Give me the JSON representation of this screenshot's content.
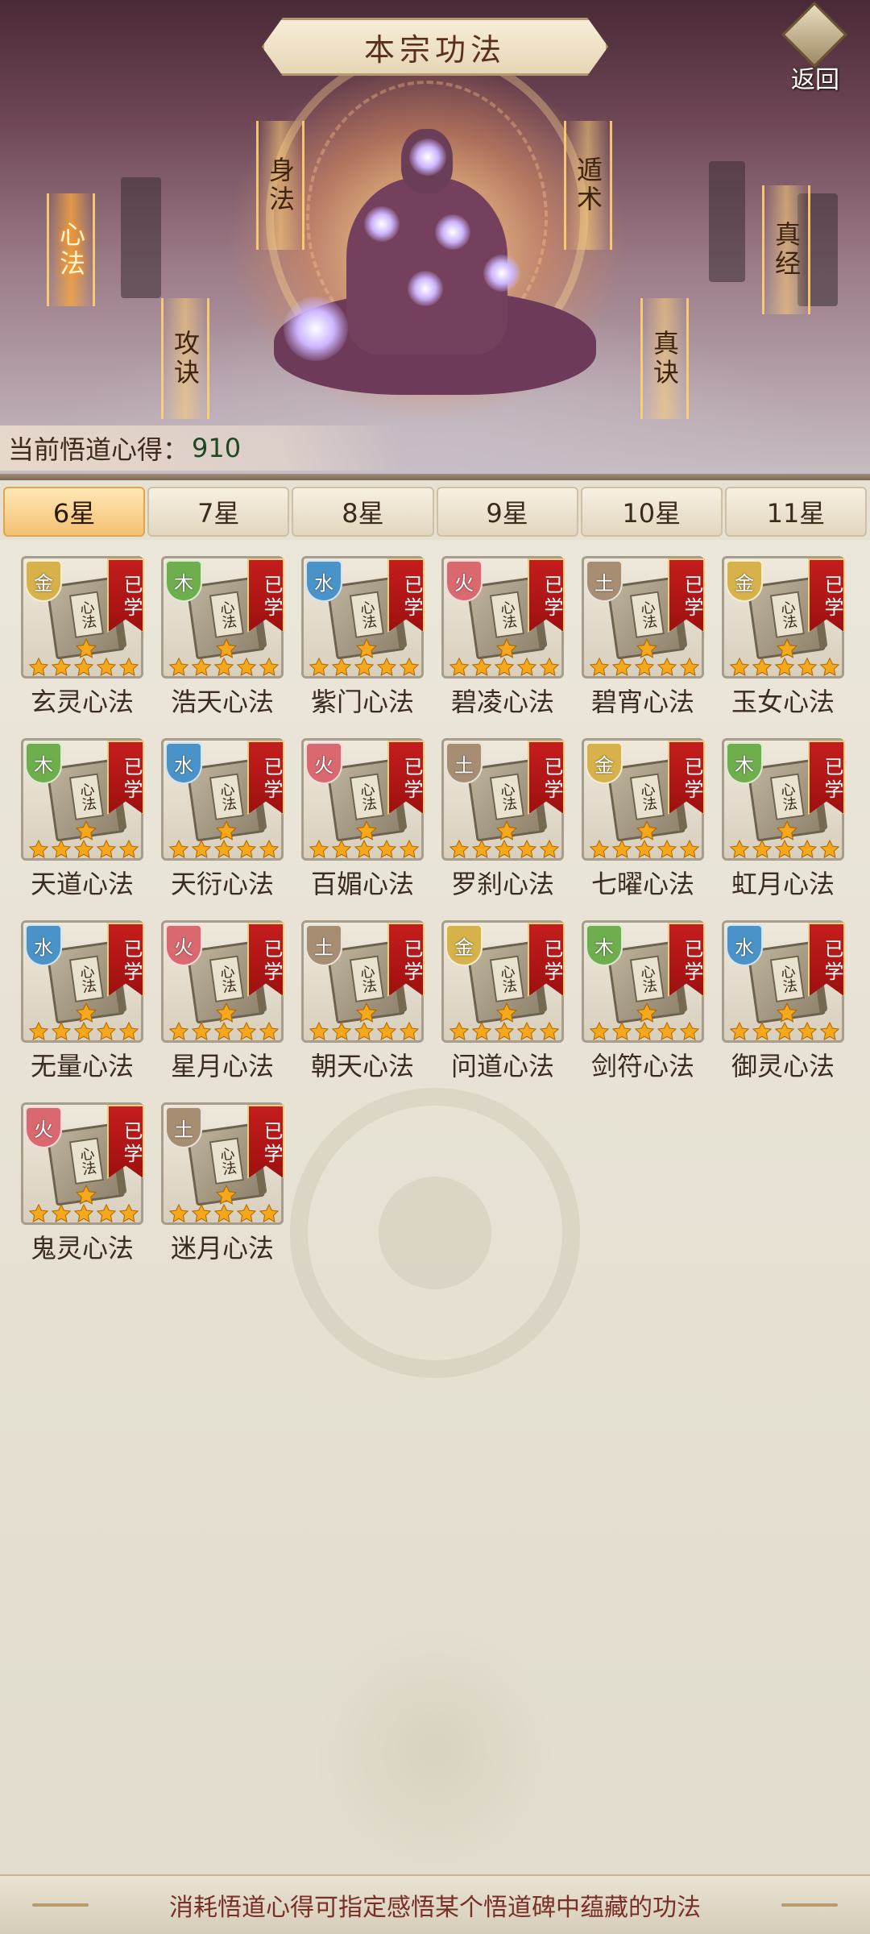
{
  "header": {
    "title": "本宗功法",
    "back_label": "返回"
  },
  "categories": [
    {
      "id": "xinfa",
      "label": "心法",
      "active": true
    },
    {
      "id": "shenfa",
      "label": "身法",
      "active": false
    },
    {
      "id": "gongjue",
      "label": "攻诀",
      "active": false
    },
    {
      "id": "dunshu",
      "label": "遁术",
      "active": false
    },
    {
      "id": "zhenjue",
      "label": "真诀",
      "active": false
    },
    {
      "id": "zhenjing",
      "label": "真经",
      "active": false
    }
  ],
  "insight": {
    "label": "当前悟道心得：",
    "value": "910"
  },
  "tabs": [
    {
      "label": "6星",
      "active": true
    },
    {
      "label": "7星",
      "active": false
    },
    {
      "label": "8星",
      "active": false
    },
    {
      "label": "9星",
      "active": false
    },
    {
      "label": "10星",
      "active": false
    },
    {
      "label": "11星",
      "active": false
    }
  ],
  "learned_label": "已学",
  "book_plate_text": "心法",
  "element_colors": {
    "金": "#d7b24a",
    "木": "#6fae4c",
    "水": "#4a93c8",
    "火": "#d9696f",
    "土": "#a78d72"
  },
  "star_color": "#f5a81c",
  "skills": [
    {
      "name": "玄灵心法",
      "element": "金",
      "stars": 6,
      "learned": true
    },
    {
      "name": "浩天心法",
      "element": "木",
      "stars": 6,
      "learned": true
    },
    {
      "name": "紫门心法",
      "element": "水",
      "stars": 6,
      "learned": true
    },
    {
      "name": "碧凌心法",
      "element": "火",
      "stars": 6,
      "learned": true
    },
    {
      "name": "碧宵心法",
      "element": "土",
      "stars": 6,
      "learned": true
    },
    {
      "name": "玉女心法",
      "element": "金",
      "stars": 6,
      "learned": true
    },
    {
      "name": "天道心法",
      "element": "木",
      "stars": 6,
      "learned": true
    },
    {
      "name": "天衍心法",
      "element": "水",
      "stars": 6,
      "learned": true
    },
    {
      "name": "百媚心法",
      "element": "火",
      "stars": 6,
      "learned": true
    },
    {
      "name": "罗刹心法",
      "element": "土",
      "stars": 6,
      "learned": true
    },
    {
      "name": "七曜心法",
      "element": "金",
      "stars": 6,
      "learned": true
    },
    {
      "name": "虹月心法",
      "element": "木",
      "stars": 6,
      "learned": true
    },
    {
      "name": "无量心法",
      "element": "水",
      "stars": 6,
      "learned": true
    },
    {
      "name": "星月心法",
      "element": "火",
      "stars": 6,
      "learned": true
    },
    {
      "name": "朝天心法",
      "element": "土",
      "stars": 6,
      "learned": true
    },
    {
      "name": "问道心法",
      "element": "金",
      "stars": 6,
      "learned": true
    },
    {
      "name": "剑符心法",
      "element": "木",
      "stars": 6,
      "learned": true
    },
    {
      "name": "御灵心法",
      "element": "水",
      "stars": 6,
      "learned": true
    },
    {
      "name": "鬼灵心法",
      "element": "火",
      "stars": 6,
      "learned": true
    },
    {
      "name": "迷月心法",
      "element": "土",
      "stars": 6,
      "learned": true
    }
  ],
  "footer": {
    "hint": "消耗悟道心得可指定感悟某个悟道碑中蕴藏的功法"
  }
}
